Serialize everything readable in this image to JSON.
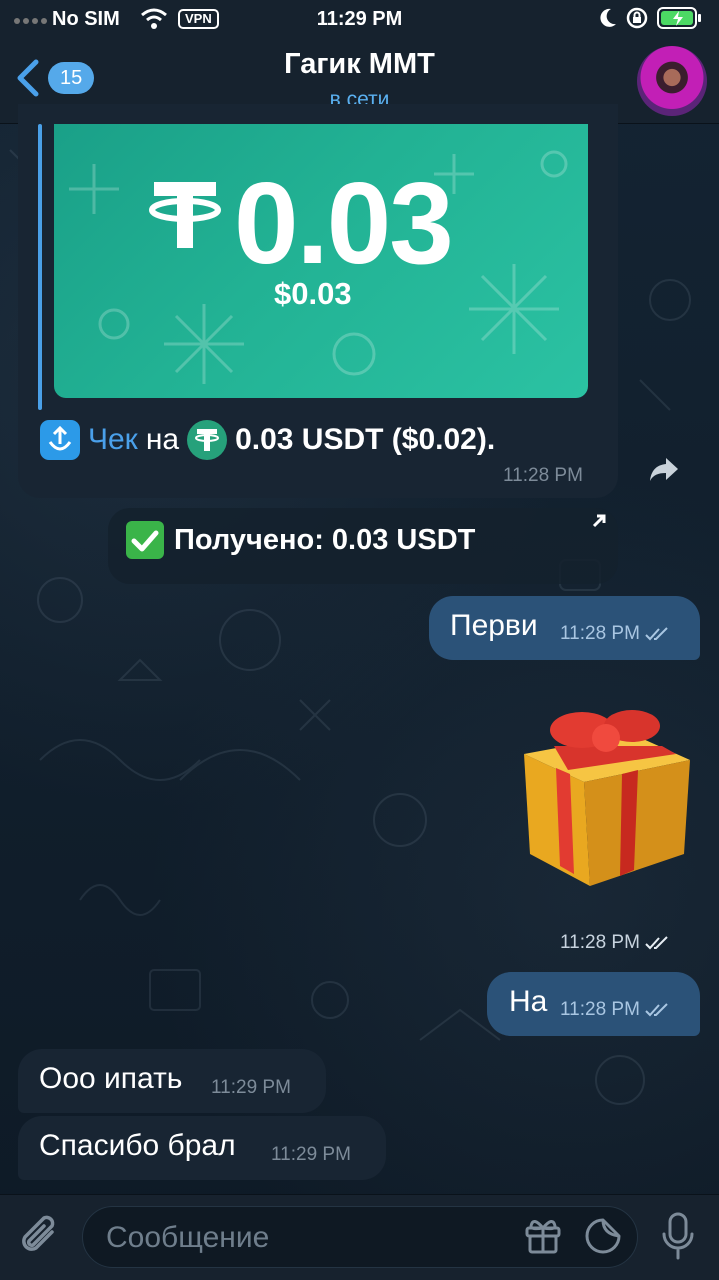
{
  "status_bar": {
    "carrier": "No SIM",
    "vpn": "VPN",
    "time": "11:29 PM"
  },
  "header": {
    "back_badge": "15",
    "title": "Гагик ММТ",
    "subtitle": "в сети"
  },
  "check_message": {
    "amount": "0.03",
    "amount_usd": "$0.03",
    "link_text": "Чек",
    "preposition": "на",
    "value_text": "0.03 USDT ($0.02).",
    "time": "11:28 PM"
  },
  "service_message": {
    "text": "Получено: 0.03 USDT"
  },
  "outgoing": [
    {
      "text": "Перви",
      "time": "11:28 PM"
    },
    {
      "text": "На",
      "time": "11:28 PM"
    }
  ],
  "gift_time": "11:28 PM",
  "incoming": [
    {
      "text": "Ооо ипать",
      "time": "11:29 PM"
    },
    {
      "text": "Спасибо брал",
      "time": "11:29 PM"
    }
  ],
  "composer": {
    "placeholder": "Сообщение"
  },
  "colors": {
    "accent": "#4aa0ea",
    "outgoing_bubble": "#2b5278",
    "incoming_bubble": "#182533",
    "check_card": "#22b294"
  },
  "icons": [
    "signal-icon",
    "wifi-icon",
    "moon-icon",
    "rotation-lock-icon",
    "battery-icon",
    "back-chevron-icon",
    "share-icon",
    "open-arrow-icon",
    "attach-icon",
    "gift-icon",
    "sticker-icon",
    "mic-icon",
    "read-ticks-icon"
  ]
}
